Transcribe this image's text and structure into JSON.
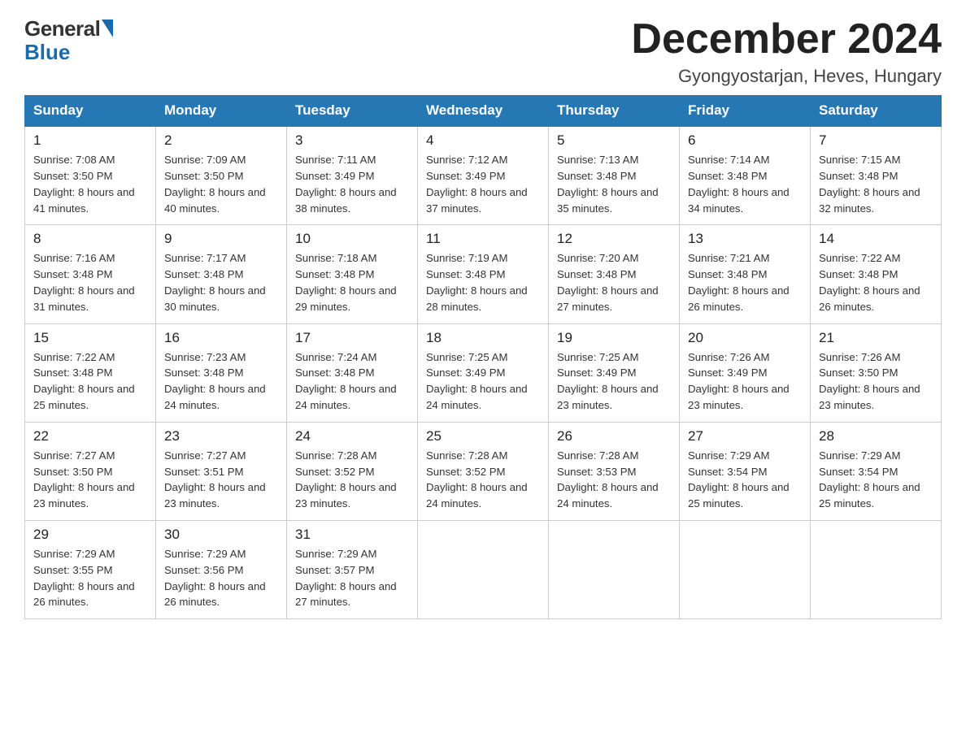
{
  "logo": {
    "general": "General",
    "blue": "Blue"
  },
  "title": "December 2024",
  "subtitle": "Gyongyostarjan, Heves, Hungary",
  "days_of_week": [
    "Sunday",
    "Monday",
    "Tuesday",
    "Wednesday",
    "Thursday",
    "Friday",
    "Saturday"
  ],
  "weeks": [
    [
      {
        "day": "1",
        "sunrise": "7:08 AM",
        "sunset": "3:50 PM",
        "daylight": "8 hours and 41 minutes."
      },
      {
        "day": "2",
        "sunrise": "7:09 AM",
        "sunset": "3:50 PM",
        "daylight": "8 hours and 40 minutes."
      },
      {
        "day": "3",
        "sunrise": "7:11 AM",
        "sunset": "3:49 PM",
        "daylight": "8 hours and 38 minutes."
      },
      {
        "day": "4",
        "sunrise": "7:12 AM",
        "sunset": "3:49 PM",
        "daylight": "8 hours and 37 minutes."
      },
      {
        "day": "5",
        "sunrise": "7:13 AM",
        "sunset": "3:48 PM",
        "daylight": "8 hours and 35 minutes."
      },
      {
        "day": "6",
        "sunrise": "7:14 AM",
        "sunset": "3:48 PM",
        "daylight": "8 hours and 34 minutes."
      },
      {
        "day": "7",
        "sunrise": "7:15 AM",
        "sunset": "3:48 PM",
        "daylight": "8 hours and 32 minutes."
      }
    ],
    [
      {
        "day": "8",
        "sunrise": "7:16 AM",
        "sunset": "3:48 PM",
        "daylight": "8 hours and 31 minutes."
      },
      {
        "day": "9",
        "sunrise": "7:17 AM",
        "sunset": "3:48 PM",
        "daylight": "8 hours and 30 minutes."
      },
      {
        "day": "10",
        "sunrise": "7:18 AM",
        "sunset": "3:48 PM",
        "daylight": "8 hours and 29 minutes."
      },
      {
        "day": "11",
        "sunrise": "7:19 AM",
        "sunset": "3:48 PM",
        "daylight": "8 hours and 28 minutes."
      },
      {
        "day": "12",
        "sunrise": "7:20 AM",
        "sunset": "3:48 PM",
        "daylight": "8 hours and 27 minutes."
      },
      {
        "day": "13",
        "sunrise": "7:21 AM",
        "sunset": "3:48 PM",
        "daylight": "8 hours and 26 minutes."
      },
      {
        "day": "14",
        "sunrise": "7:22 AM",
        "sunset": "3:48 PM",
        "daylight": "8 hours and 26 minutes."
      }
    ],
    [
      {
        "day": "15",
        "sunrise": "7:22 AM",
        "sunset": "3:48 PM",
        "daylight": "8 hours and 25 minutes."
      },
      {
        "day": "16",
        "sunrise": "7:23 AM",
        "sunset": "3:48 PM",
        "daylight": "8 hours and 24 minutes."
      },
      {
        "day": "17",
        "sunrise": "7:24 AM",
        "sunset": "3:48 PM",
        "daylight": "8 hours and 24 minutes."
      },
      {
        "day": "18",
        "sunrise": "7:25 AM",
        "sunset": "3:49 PM",
        "daylight": "8 hours and 24 minutes."
      },
      {
        "day": "19",
        "sunrise": "7:25 AM",
        "sunset": "3:49 PM",
        "daylight": "8 hours and 23 minutes."
      },
      {
        "day": "20",
        "sunrise": "7:26 AM",
        "sunset": "3:49 PM",
        "daylight": "8 hours and 23 minutes."
      },
      {
        "day": "21",
        "sunrise": "7:26 AM",
        "sunset": "3:50 PM",
        "daylight": "8 hours and 23 minutes."
      }
    ],
    [
      {
        "day": "22",
        "sunrise": "7:27 AM",
        "sunset": "3:50 PM",
        "daylight": "8 hours and 23 minutes."
      },
      {
        "day": "23",
        "sunrise": "7:27 AM",
        "sunset": "3:51 PM",
        "daylight": "8 hours and 23 minutes."
      },
      {
        "day": "24",
        "sunrise": "7:28 AM",
        "sunset": "3:52 PM",
        "daylight": "8 hours and 23 minutes."
      },
      {
        "day": "25",
        "sunrise": "7:28 AM",
        "sunset": "3:52 PM",
        "daylight": "8 hours and 24 minutes."
      },
      {
        "day": "26",
        "sunrise": "7:28 AM",
        "sunset": "3:53 PM",
        "daylight": "8 hours and 24 minutes."
      },
      {
        "day": "27",
        "sunrise": "7:29 AM",
        "sunset": "3:54 PM",
        "daylight": "8 hours and 25 minutes."
      },
      {
        "day": "28",
        "sunrise": "7:29 AM",
        "sunset": "3:54 PM",
        "daylight": "8 hours and 25 minutes."
      }
    ],
    [
      {
        "day": "29",
        "sunrise": "7:29 AM",
        "sunset": "3:55 PM",
        "daylight": "8 hours and 26 minutes."
      },
      {
        "day": "30",
        "sunrise": "7:29 AM",
        "sunset": "3:56 PM",
        "daylight": "8 hours and 26 minutes."
      },
      {
        "day": "31",
        "sunrise": "7:29 AM",
        "sunset": "3:57 PM",
        "daylight": "8 hours and 27 minutes."
      },
      null,
      null,
      null,
      null
    ]
  ]
}
